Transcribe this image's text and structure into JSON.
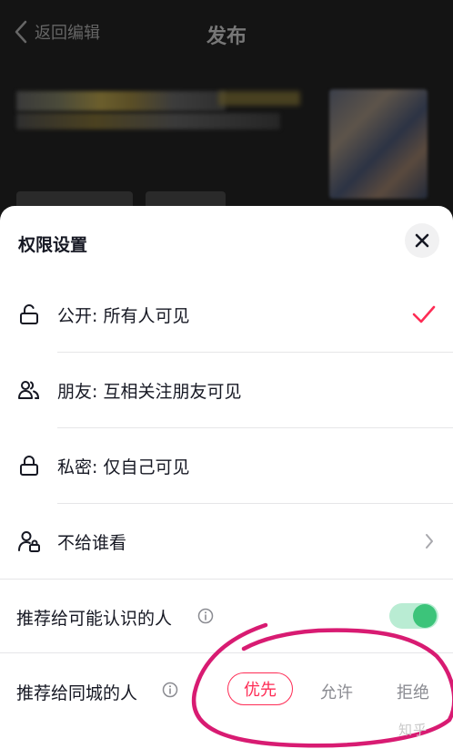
{
  "header": {
    "back_label": "返回编辑",
    "title": "发布"
  },
  "sheet": {
    "title": "权限设置",
    "options": [
      {
        "label": "公开: 所有人可见",
        "selected": true,
        "icon": "unlock-icon"
      },
      {
        "label": "朋友: 互相关注朋友可见",
        "selected": false,
        "icon": "friends-icon"
      },
      {
        "label": "私密: 仅自己可见",
        "selected": false,
        "icon": "lock-icon"
      },
      {
        "label": "不给谁看",
        "selected": false,
        "icon": "user-lock-icon"
      }
    ],
    "recommend_known": {
      "label": "推荐给可能认识的人",
      "enabled": true
    },
    "recommend_city": {
      "label": "推荐给同城的人",
      "choices": [
        "优先",
        "允许",
        "拒绝"
      ],
      "selected": "优先"
    }
  },
  "watermark": "知乎",
  "colors": {
    "accent": "#fe2c55",
    "toggle_on": "#3cc47a",
    "annotation": "#d81b72"
  }
}
